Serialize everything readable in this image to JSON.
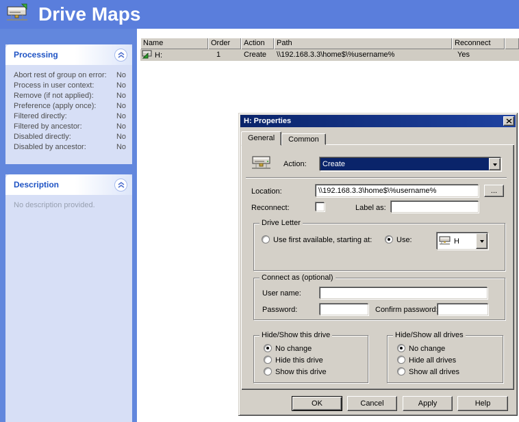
{
  "header": {
    "title": "Drive Maps",
    "icon": "drive-maps-icon"
  },
  "colors": {
    "header_blue": "#5a7edc",
    "sidebar_blue": "#6287dd",
    "panel_bg": "#d7dff6",
    "panel_title": "#1e53c4",
    "dialog_bg": "#d4d0c8",
    "titlebar_dark": "#0a246a",
    "titlebar_light": "#1f42a0",
    "selection": "#0a246a",
    "row_selected": "#d0ccc3"
  },
  "sidebar": {
    "processing": {
      "title": "Processing",
      "items": [
        {
          "label": "Abort rest of group on error:",
          "value": "No"
        },
        {
          "label": "Process in user context:",
          "value": "No"
        },
        {
          "label": "Remove (if not applied):",
          "value": "No"
        },
        {
          "label": "Preference (apply once):",
          "value": "No"
        },
        {
          "label": "Filtered directly:",
          "value": "No"
        },
        {
          "label": "Filtered by ancestor:",
          "value": "No"
        },
        {
          "label": "Disabled directly:",
          "value": "No"
        },
        {
          "label": "Disabled by ancestor:",
          "value": "No"
        }
      ]
    },
    "description": {
      "title": "Description",
      "text": "No description provided."
    }
  },
  "table": {
    "columns": [
      "Name",
      "Order",
      "Action",
      "Path",
      "Reconnect"
    ],
    "rows": [
      {
        "name": "H:",
        "order": "1",
        "action": "Create",
        "path": "\\\\192.168.3.3\\home$\\%username%",
        "reconnect": "Yes"
      }
    ]
  },
  "dialog": {
    "title": "H: Properties",
    "close_icon": "close-icon",
    "tabs": [
      {
        "label": "General",
        "active": true
      },
      {
        "label": "Common",
        "active": false
      }
    ],
    "action": {
      "label": "Action:",
      "value": "Create"
    },
    "location": {
      "label": "Location:",
      "value": "\\\\192.168.3.3\\home$\\%username%",
      "browse_label": "..."
    },
    "reconnect": {
      "label": "Reconnect:",
      "checked": false
    },
    "label_as": {
      "label": "Label as:",
      "value": ""
    },
    "drive_letter": {
      "title": "Drive Letter",
      "first_available": {
        "label": "Use first available, starting at:",
        "selected": false
      },
      "use": {
        "label": "Use:",
        "selected": true,
        "value": "H"
      }
    },
    "connect_as": {
      "title": "Connect as (optional)",
      "user_name": {
        "label": "User name:",
        "value": ""
      },
      "password": {
        "label": "Password:",
        "value": ""
      },
      "confirm_password": {
        "label": "Confirm password:",
        "value": ""
      }
    },
    "hide_show_this": {
      "title": "Hide/Show this drive",
      "options": [
        {
          "label": "No change",
          "selected": true
        },
        {
          "label": "Hide this drive",
          "selected": false
        },
        {
          "label": "Show this drive",
          "selected": false
        }
      ]
    },
    "hide_show_all": {
      "title": "Hide/Show all drives",
      "options": [
        {
          "label": "No change",
          "selected": true
        },
        {
          "label": "Hide all drives",
          "selected": false
        },
        {
          "label": "Show all drives",
          "selected": false
        }
      ]
    },
    "buttons": {
      "ok": "OK",
      "cancel": "Cancel",
      "apply": "Apply",
      "help": "Help"
    }
  }
}
